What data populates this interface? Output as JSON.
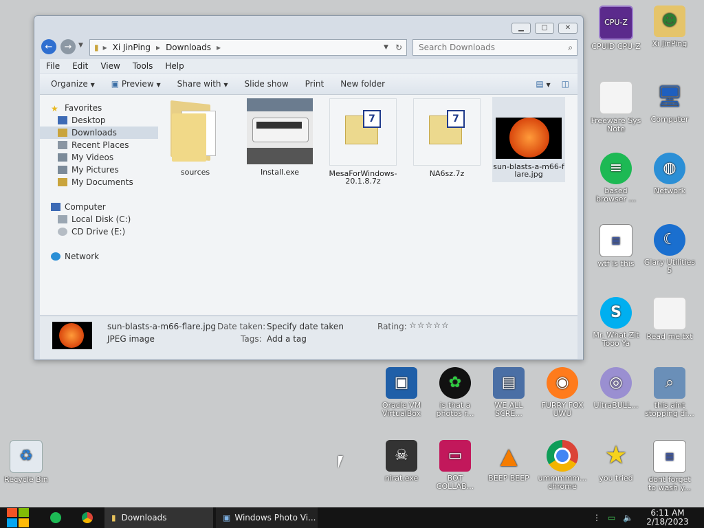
{
  "window": {
    "breadcrumb": [
      "Xi JinPing",
      "Downloads"
    ],
    "search_placeholder": "Search Downloads",
    "menu": [
      "File",
      "Edit",
      "View",
      "Tools",
      "Help"
    ],
    "toolbar": [
      "Organize",
      "Preview",
      "Share with",
      "Slide show",
      "Print",
      "New folder"
    ],
    "nav_favorites": "Favorites",
    "nav_fav_items": [
      "Desktop",
      "Downloads",
      "Recent Places",
      "My Videos",
      "My Pictures",
      "My Documents"
    ],
    "nav_computer": "Computer",
    "nav_computer_items": [
      "Local Disk (C:)",
      "CD Drive (E:)"
    ],
    "nav_network": "Network",
    "files": [
      {
        "name": "sources"
      },
      {
        "name": "Install.exe"
      },
      {
        "name": "MesaForWindows-20.1.8.7z"
      },
      {
        "name": "NA6sz.7z"
      },
      {
        "name": "sun-blasts-a-m66-flare.jpg"
      }
    ],
    "details": {
      "filename": "sun-blasts-a-m66-flare.jpg",
      "filetype": "JPEG image",
      "date_label": "Date taken:",
      "date_value": "Specify date taken",
      "tags_label": "Tags:",
      "tags_value": "Add a tag",
      "rating_label": "Rating:",
      "rating_stars": "☆☆☆☆☆"
    }
  },
  "desktop": {
    "icons": [
      {
        "label": "CPUID CPU-Z"
      },
      {
        "label": "Xi JinPing"
      },
      {
        "label": "Freeware Sys Note"
      },
      {
        "label": "Computer"
      },
      {
        "label": "based browser ..."
      },
      {
        "label": "Network"
      },
      {
        "label": "wtf is this"
      },
      {
        "label": "Glary Utilities 5"
      },
      {
        "label": "Mr. What Zit Tooo Ya"
      },
      {
        "label": "Read me.txt"
      },
      {
        "label": "Oracle VM VirtualBox"
      },
      {
        "label": "is that a photos r..."
      },
      {
        "label": "WE ALL SCRE..."
      },
      {
        "label": "FURRY FOX UWU"
      },
      {
        "label": "UltraBULL..."
      },
      {
        "label": "this aint stopping di..."
      },
      {
        "label": "Recycle Bin"
      },
      {
        "label": "nirat.exe"
      },
      {
        "label": "BOT COLLAB..."
      },
      {
        "label": "BEEP BEEP"
      },
      {
        "label": "ummmmm... chrome"
      },
      {
        "label": "you tried"
      },
      {
        "label": "dont forget to wash y..."
      }
    ]
  },
  "taskbar": {
    "tasks": [
      "Downloads",
      "Windows Photo Vi..."
    ],
    "time": "6:11 AM",
    "date": "2/18/2023"
  }
}
